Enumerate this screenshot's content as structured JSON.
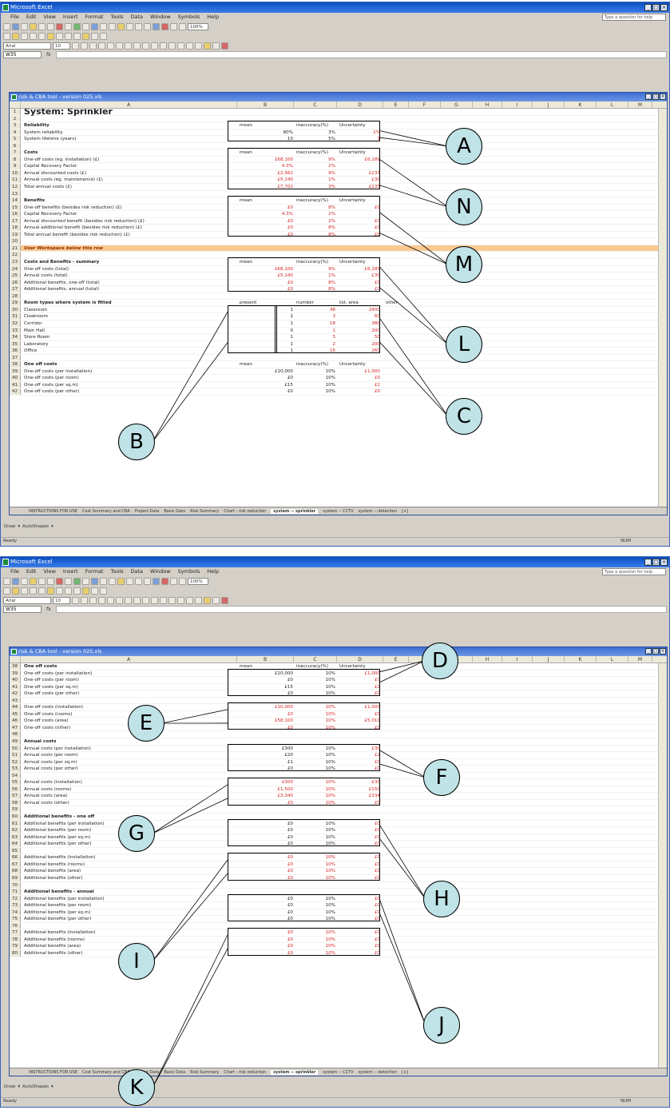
{
  "app_title": "Microsoft Excel",
  "workbook_title": "risk & CBA tool - version 025.xls",
  "menus": [
    "File",
    "Edit",
    "View",
    "Insert",
    "Format",
    "Tools",
    "Data",
    "Window",
    "Symbols",
    "Help"
  ],
  "help_placeholder": "Type a question for help",
  "font_name": "Arial",
  "font_size": "10",
  "zoom": "100%",
  "columns": [
    "A",
    "B",
    "C",
    "D",
    "E",
    "F",
    "G",
    "H",
    "I",
    "J",
    "K",
    "L",
    "M"
  ],
  "screen1": {
    "name_box": "W35",
    "rows": [
      {
        "n": "1",
        "a": "System: Sprinkler",
        "style": "title"
      },
      {
        "n": "2",
        "a": ""
      },
      {
        "n": "3",
        "a": "Reliability",
        "style": "bold",
        "b": "mean",
        "c": "inaccuracy(%)",
        "d": "Uncertainty"
      },
      {
        "n": "4",
        "a": "System reliability",
        "b": "80%",
        "c": "3%",
        "d": "2%",
        "dr": true
      },
      {
        "n": "5",
        "a": "System lifetime (years)",
        "b": "10",
        "c": "5%",
        "d": "1",
        "dr": true
      },
      {
        "n": "6",
        "a": ""
      },
      {
        "n": "7",
        "a": "Costs",
        "style": "bold",
        "b": "mean",
        "c": "inaccuracy(%)",
        "d": "Uncertainty"
      },
      {
        "n": "8",
        "a": "One-off costs (eg. installation) (£)",
        "b": "£68,100",
        "c": "9%",
        "d": "£6,189",
        "br": true,
        "cr": true,
        "dr": true
      },
      {
        "n": "9",
        "a": "Capital Recovery Factor",
        "b": "4.3%",
        "c": "2%",
        "br": true,
        "cr": true
      },
      {
        "n": "10",
        "a": "Annual discounted costs (£)",
        "b": "£2,562",
        "c": "9%",
        "d": "£233",
        "br": true,
        "cr": true,
        "dr": true
      },
      {
        "n": "11",
        "a": "Annual costs (eg. maintenance) (£)",
        "b": "£5,140",
        "c": "1%",
        "d": "£30",
        "br": true,
        "cr": true,
        "dr": true
      },
      {
        "n": "12",
        "a": "Total annual costs (£)",
        "b": "£7,702",
        "c": "3%",
        "d": "£235",
        "br": true,
        "cr": true,
        "dr": true
      },
      {
        "n": "13",
        "a": ""
      },
      {
        "n": "14",
        "a": "Benefits",
        "style": "bold",
        "b": "mean",
        "c": "inaccuracy(%)",
        "d": "Uncertainty"
      },
      {
        "n": "15",
        "a": "One-off benefits (besides risk reduction) (£)",
        "b": "£0",
        "c": "8%",
        "d": "£0",
        "br": true,
        "cr": true,
        "dr": true
      },
      {
        "n": "16",
        "a": "Capital Recovery Factor",
        "b": "4.3%",
        "c": "2%",
        "br": true,
        "cr": true
      },
      {
        "n": "17",
        "a": "Annual discounted benefit (besides risk reduction) (£)",
        "b": "£0",
        "c": "2%",
        "d": "£0",
        "br": true,
        "cr": true,
        "dr": true
      },
      {
        "n": "18",
        "a": "Annual additional benefit (besides risk reduction) (£)",
        "b": "£0",
        "c": "8%",
        "d": "£0",
        "br": true,
        "cr": true,
        "dr": true
      },
      {
        "n": "19",
        "a": "Total annual benefit (besides risk reduction) (£)",
        "b": "£0",
        "c": "8%",
        "d": "£0",
        "br": true,
        "cr": true,
        "dr": true
      },
      {
        "n": "20",
        "a": ""
      },
      {
        "n": "21",
        "a": "User Workspace below this row",
        "style": "orange"
      },
      {
        "n": "22",
        "a": ""
      },
      {
        "n": "23",
        "a": "Costs and Benefits - summary",
        "style": "bold",
        "b": "mean",
        "c": "inaccuracy(%)",
        "d": "Uncertainty"
      },
      {
        "n": "24",
        "a": "One-off costs (total)",
        "b": "£68,100",
        "c": "9%",
        "d": "£6,189",
        "br": true,
        "cr": true,
        "dr": true
      },
      {
        "n": "25",
        "a": "Annual costs (total)",
        "b": "£5,140",
        "c": "1%",
        "d": "£30",
        "br": true,
        "cr": true,
        "dr": true
      },
      {
        "n": "26",
        "a": "Additional benefits, one-off (total)",
        "b": "£0",
        "c": "8%",
        "d": "£0",
        "br": true,
        "cr": true,
        "dr": true
      },
      {
        "n": "27",
        "a": "Additional benefits, annual (total)",
        "b": "£0",
        "c": "8%",
        "d": "£0",
        "br": true,
        "cr": true,
        "dr": true
      },
      {
        "n": "28",
        "a": ""
      },
      {
        "n": "29",
        "a": "Room types where system is fitted",
        "style": "bold",
        "b": "present",
        "c": "number",
        "d": "tot. area",
        "e": "other"
      },
      {
        "n": "30",
        "a": "Classroom",
        "b": "1",
        "c": "48",
        "d": "2400",
        "cr": true,
        "dr": true
      },
      {
        "n": "31",
        "a": "Cloakroom",
        "b": "1",
        "c": "3",
        "d": "60",
        "cr": true,
        "dr": true
      },
      {
        "n": "32",
        "a": "Corridor",
        "b": "1",
        "c": "18",
        "d": "380",
        "cr": true,
        "dr": true
      },
      {
        "n": "33",
        "a": "Main Hall",
        "b": "0",
        "c": "1",
        "d": "200",
        "cr": true,
        "dr": true
      },
      {
        "n": "34",
        "a": "Store Room",
        "b": "1",
        "c": "5",
        "d": "50",
        "cr": true,
        "dr": true
      },
      {
        "n": "35",
        "a": "Laboratory",
        "b": "1",
        "c": "2",
        "d": "200",
        "cr": true,
        "dr": true
      },
      {
        "n": "36",
        "a": "Office",
        "b": "1",
        "c": "16",
        "d": "260",
        "cr": true,
        "dr": true
      },
      {
        "n": "37",
        "a": ""
      },
      {
        "n": "38",
        "a": "One off costs",
        "style": "bold",
        "b": "mean",
        "c": "inaccuracy(%)",
        "d": "Uncertainty"
      },
      {
        "n": "39",
        "a": "One-off costs (per installation)",
        "b": "£10,000",
        "c": "10%",
        "d": "£1,000",
        "dr": true
      },
      {
        "n": "40",
        "a": "One-off costs (per room)",
        "b": "£0",
        "c": "10%",
        "d": "£0",
        "dr": true
      },
      {
        "n": "41",
        "a": "One-off costs (per sq.m)",
        "b": "£15",
        "c": "10%",
        "d": "£2",
        "dr": true
      },
      {
        "n": "42",
        "a": "One-off costs (per other)",
        "b": "£0",
        "c": "10%",
        "d": "£0",
        "dr": true
      }
    ]
  },
  "screen2": {
    "name_box": "W35",
    "rows": [
      {
        "n": "38",
        "a": "One off costs",
        "style": "bold",
        "b": "mean",
        "c": "inaccuracy(%)",
        "d": "Uncertainty"
      },
      {
        "n": "39",
        "a": "One-off costs (per installation)",
        "b": "£10,000",
        "c": "10%",
        "d": "£1,000",
        "dr": true
      },
      {
        "n": "40",
        "a": "One-off costs (per room)",
        "b": "£0",
        "c": "10%",
        "d": "£0",
        "dr": true
      },
      {
        "n": "41",
        "a": "One-off costs (per sq.m)",
        "b": "£15",
        "c": "10%",
        "d": "£2",
        "dr": true
      },
      {
        "n": "42",
        "a": "One-off costs (per other)",
        "b": "£0",
        "c": "10%",
        "d": "£0",
        "dr": true
      },
      {
        "n": "43",
        "a": ""
      },
      {
        "n": "44",
        "a": "One-off costs (installation)",
        "b": "£10,000",
        "c": "10%",
        "d": "£1,000",
        "br": true,
        "cr": true,
        "dr": true
      },
      {
        "n": "45",
        "a": "One-off costs (rooms)",
        "b": "£0",
        "c": "10%",
        "d": "£0",
        "br": true,
        "cr": true,
        "dr": true
      },
      {
        "n": "46",
        "a": "One-off costs (area)",
        "b": "£58,100",
        "c": "10%",
        "d": "£5,010",
        "br": true,
        "cr": true,
        "dr": true
      },
      {
        "n": "47",
        "a": "One-off costs (other)",
        "b": "£0",
        "c": "10%",
        "d": "£0",
        "br": true,
        "cr": true,
        "dr": true
      },
      {
        "n": "48",
        "a": ""
      },
      {
        "n": "49",
        "a": "Annual costs",
        "style": "bold"
      },
      {
        "n": "50",
        "a": "Annual costs (per installation)",
        "b": "£300",
        "c": "10%",
        "d": "£30",
        "dr": true
      },
      {
        "n": "51",
        "a": "Annual costs (per room)",
        "b": "£20",
        "c": "10%",
        "d": "£2",
        "dr": true
      },
      {
        "n": "52",
        "a": "Annual costs (per sq.m)",
        "b": "£1",
        "c": "10%",
        "d": "£0",
        "dr": true
      },
      {
        "n": "53",
        "a": "Annual costs (per other)",
        "b": "£0",
        "c": "10%",
        "d": "£0",
        "dr": true
      },
      {
        "n": "54",
        "a": ""
      },
      {
        "n": "55",
        "a": "Annual costs (installation)",
        "b": "£300",
        "c": "10%",
        "d": "£30",
        "br": true,
        "cr": true,
        "dr": true
      },
      {
        "n": "56",
        "a": "Annual costs (rooms)",
        "b": "£1,500",
        "c": "10%",
        "d": "£150",
        "br": true,
        "cr": true,
        "dr": true
      },
      {
        "n": "57",
        "a": "Annual costs (area)",
        "b": "£3,340",
        "c": "10%",
        "d": "£334",
        "br": true,
        "cr": true,
        "dr": true
      },
      {
        "n": "58",
        "a": "Annual costs (other)",
        "b": "£0",
        "c": "10%",
        "d": "£0",
        "br": true,
        "cr": true,
        "dr": true
      },
      {
        "n": "59",
        "a": ""
      },
      {
        "n": "60",
        "a": "Additional benefits - one off",
        "style": "bold"
      },
      {
        "n": "61",
        "a": "Additional benefits (per installation)",
        "b": "£0",
        "c": "10%",
        "d": "£0",
        "dr": true
      },
      {
        "n": "62",
        "a": "Additional benefits (per room)",
        "b": "£0",
        "c": "10%",
        "d": "£0",
        "dr": true
      },
      {
        "n": "63",
        "a": "Additional benefits (per sq.m)",
        "b": "£0",
        "c": "10%",
        "d": "£0",
        "dr": true
      },
      {
        "n": "64",
        "a": "Additional benefits (per other)",
        "b": "£0",
        "c": "10%",
        "d": "£0",
        "dr": true
      },
      {
        "n": "65",
        "a": ""
      },
      {
        "n": "66",
        "a": "Additional benefits (installation)",
        "b": "£0",
        "c": "10%",
        "d": "£0",
        "br": true,
        "cr": true,
        "dr": true
      },
      {
        "n": "67",
        "a": "Additional benefits (rooms)",
        "b": "£0",
        "c": "10%",
        "d": "£0",
        "br": true,
        "cr": true,
        "dr": true
      },
      {
        "n": "68",
        "a": "Additional benefits (area)",
        "b": "£0",
        "c": "10%",
        "d": "£0",
        "br": true,
        "cr": true,
        "dr": true
      },
      {
        "n": "69",
        "a": "Additional benefits (other)",
        "b": "£0",
        "c": "10%",
        "d": "£0",
        "br": true,
        "cr": true,
        "dr": true
      },
      {
        "n": "70",
        "a": ""
      },
      {
        "n": "71",
        "a": "Additional benefits - annual",
        "style": "bold"
      },
      {
        "n": "72",
        "a": "Additional benefits (per installation)",
        "b": "£0",
        "c": "10%",
        "d": "£0",
        "dr": true
      },
      {
        "n": "73",
        "a": "Additional benefits (per room)",
        "b": "£0",
        "c": "10%",
        "d": "£0",
        "dr": true
      },
      {
        "n": "74",
        "a": "Additional benefits (per sq.m)",
        "b": "£0",
        "c": "10%",
        "d": "£0",
        "dr": true
      },
      {
        "n": "75",
        "a": "Additional benefits (per other)",
        "b": "£0",
        "c": "10%",
        "d": "£0",
        "dr": true
      },
      {
        "n": "76",
        "a": ""
      },
      {
        "n": "77",
        "a": "Additional benefits (installation)",
        "b": "£0",
        "c": "10%",
        "d": "£0",
        "br": true,
        "cr": true,
        "dr": true
      },
      {
        "n": "78",
        "a": "Additional benefits (rooms)",
        "b": "£0",
        "c": "10%",
        "d": "£0",
        "br": true,
        "cr": true,
        "dr": true
      },
      {
        "n": "79",
        "a": "Additional benefits (area)",
        "b": "£0",
        "c": "10%",
        "d": "£0",
        "br": true,
        "cr": true,
        "dr": true
      },
      {
        "n": "80",
        "a": "Additional benefits (other)",
        "b": "£0",
        "c": "10%",
        "d": "£0",
        "br": true,
        "cr": true,
        "dr": true
      }
    ]
  },
  "sheet_tabs": [
    "INSTRUCTIONS FOR USE",
    "Cost Summary and CBA",
    "Project Data",
    "Basic Data",
    "Risk Summary",
    "Chart - risk reduction",
    "system -- sprinkler",
    "system -- CCTV",
    "system -- detection",
    "[+]"
  ],
  "active_tab": "system -- sprinkler",
  "draw_label": "Draw",
  "autoshapes_label": "AutoShapes",
  "status_text": "Ready",
  "status_num": "NUM",
  "callouts_top": [
    "A",
    "N",
    "M",
    "L",
    "B",
    "C"
  ],
  "callouts_bottom": [
    "D",
    "E",
    "F",
    "G",
    "H",
    "I",
    "J",
    "K"
  ],
  "red_color": "#d21f1f",
  "callout_color": "#bfe3e7"
}
